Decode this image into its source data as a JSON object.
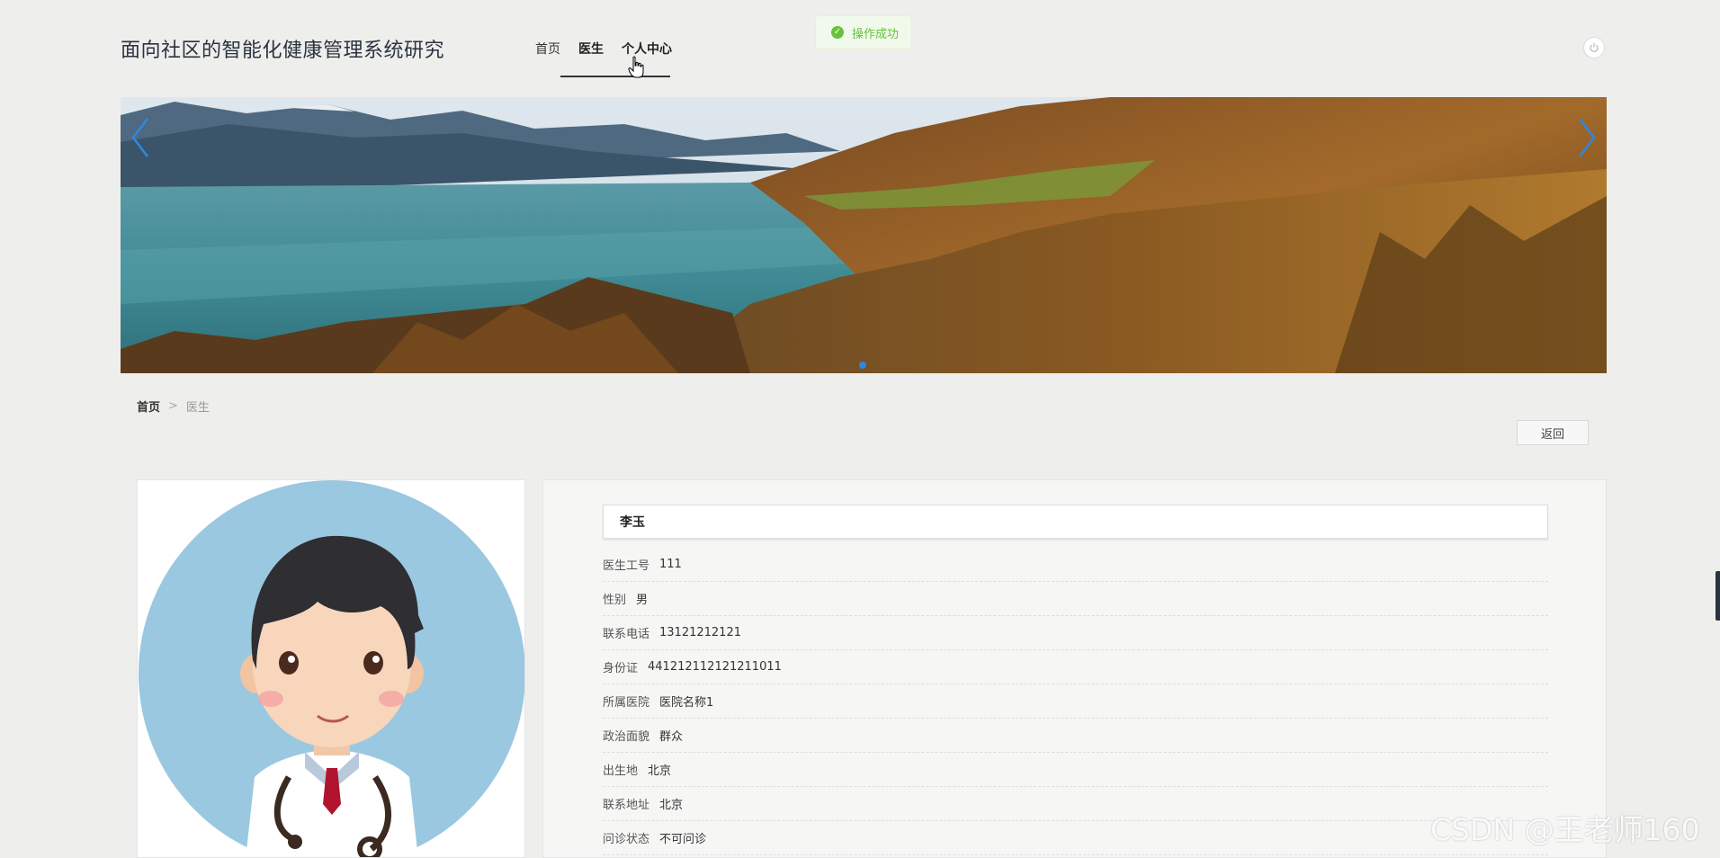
{
  "header": {
    "site_title": "面向社区的智能化健康管理系统研究",
    "nav": [
      "首页",
      "医生",
      "个人中心"
    ]
  },
  "toast": {
    "text": "操作成功",
    "icon": "check-circle-icon",
    "color": "#67c23a"
  },
  "banner": {
    "slide_count": 1,
    "active_slide": 1
  },
  "breadcrumb": {
    "home": "首页",
    "separator": ">",
    "current": "医生"
  },
  "actions": {
    "back": "返回"
  },
  "doctor": {
    "name": "李玉",
    "fields": [
      {
        "label": "医生工号",
        "value": "111"
      },
      {
        "label": "性别",
        "value": "男"
      },
      {
        "label": "联系电话",
        "value": "13121212121"
      },
      {
        "label": "身份证",
        "value": "441212112121211011"
      },
      {
        "label": "所属医院",
        "value": "医院名称1"
      },
      {
        "label": "政治面貌",
        "value": "群众"
      },
      {
        "label": "出生地",
        "value": "北京"
      },
      {
        "label": "联系地址",
        "value": "北京"
      },
      {
        "label": "问诊状态",
        "value": "不可问诊"
      }
    ]
  },
  "watermark": "CSDN @王老师160",
  "colors": {
    "accent": "#2f87e0",
    "background": "#eeeeec"
  }
}
